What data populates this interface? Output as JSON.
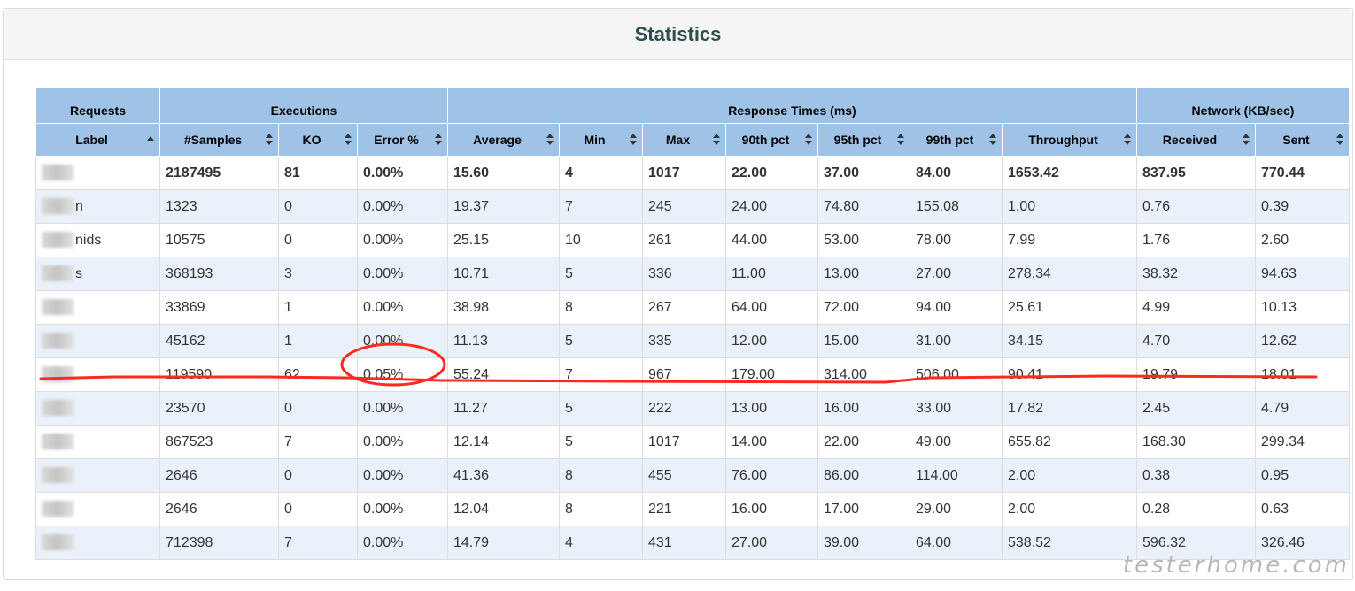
{
  "panel": {
    "title": "Statistics"
  },
  "groups": {
    "requests": "Requests",
    "executions": "Executions",
    "response_times": "Response Times (ms)",
    "network": "Network (KB/sec)"
  },
  "columns": [
    "Label",
    "#Samples",
    "KO",
    "Error %",
    "Average",
    "Min",
    "Max",
    "90th pct",
    "95th pct",
    "99th pct",
    "Throughput",
    "Received",
    "Sent"
  ],
  "total": [
    "",
    "2187495",
    "81",
    "0.00%",
    "15.60",
    "4",
    "1017",
    "22.00",
    "37.00",
    "84.00",
    "1653.42",
    "837.95",
    "770.44"
  ],
  "rows": [
    {
      "label_suffix": "n",
      "values": [
        "1323",
        "0",
        "0.00%",
        "19.37",
        "7",
        "245",
        "24.00",
        "74.80",
        "155.08",
        "1.00",
        "0.76",
        "0.39"
      ]
    },
    {
      "label_suffix": "nids",
      "values": [
        "10575",
        "0",
        "0.00%",
        "25.15",
        "10",
        "261",
        "44.00",
        "53.00",
        "78.00",
        "7.99",
        "1.76",
        "2.60"
      ]
    },
    {
      "label_suffix": "s",
      "values": [
        "368193",
        "3",
        "0.00%",
        "10.71",
        "5",
        "336",
        "11.00",
        "13.00",
        "27.00",
        "278.34",
        "38.32",
        "94.63"
      ]
    },
    {
      "label_suffix": "",
      "values": [
        "33869",
        "1",
        "0.00%",
        "38.98",
        "8",
        "267",
        "64.00",
        "72.00",
        "94.00",
        "25.61",
        "4.99",
        "10.13"
      ]
    },
    {
      "label_suffix": "",
      "values": [
        "45162",
        "1",
        "0.00%",
        "11.13",
        "5",
        "335",
        "12.00",
        "15.00",
        "31.00",
        "34.15",
        "4.70",
        "12.62"
      ]
    },
    {
      "label_suffix": "",
      "values": [
        "119590",
        "62",
        "0.05%",
        "55.24",
        "7",
        "967",
        "179.00",
        "314.00",
        "506.00",
        "90.41",
        "19.79",
        "18.01"
      ]
    },
    {
      "label_suffix": "",
      "values": [
        "23570",
        "0",
        "0.00%",
        "11.27",
        "5",
        "222",
        "13.00",
        "16.00",
        "33.00",
        "17.82",
        "2.45",
        "4.79"
      ]
    },
    {
      "label_suffix": "",
      "values": [
        "867523",
        "7",
        "0.00%",
        "12.14",
        "5",
        "1017",
        "14.00",
        "22.00",
        "49.00",
        "655.82",
        "168.30",
        "299.34"
      ]
    },
    {
      "label_suffix": "",
      "values": [
        "2646",
        "0",
        "0.00%",
        "41.36",
        "8",
        "455",
        "76.00",
        "86.00",
        "114.00",
        "2.00",
        "0.38",
        "0.95"
      ]
    },
    {
      "label_suffix": "",
      "values": [
        "2646",
        "0",
        "0.00%",
        "12.04",
        "8",
        "221",
        "16.00",
        "17.00",
        "29.00",
        "2.00",
        "0.28",
        "0.63"
      ]
    },
    {
      "label_suffix": "",
      "values": [
        "712398",
        "7",
        "0.00%",
        "14.79",
        "4",
        "431",
        "27.00",
        "39.00",
        "64.00",
        "538.52",
        "596.32",
        "326.46"
      ]
    }
  ],
  "annotation": {
    "color": "#ff2a1f",
    "highlighted_row": 5,
    "highlighted_column": "Error %"
  },
  "watermark": "testerhome.com"
}
